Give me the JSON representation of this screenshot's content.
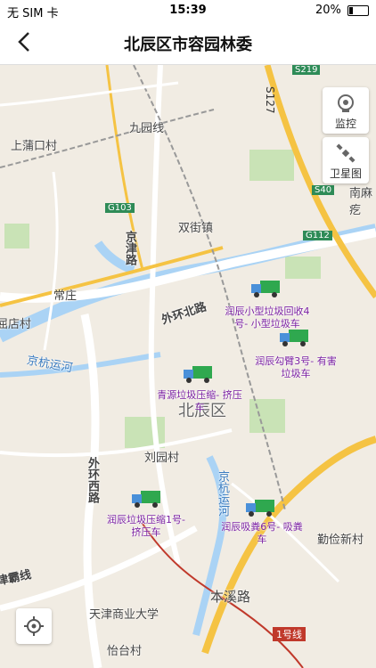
{
  "status": {
    "carrier": "无 SIM 卡",
    "time": "15:39",
    "battery": "20%"
  },
  "nav": {
    "title": "北辰区市容园林委"
  },
  "controls": {
    "monitor": "监控",
    "satellite": "卫星图"
  },
  "map_labels": {
    "beichen": "北辰区",
    "jiuyuan": "九园线",
    "shangpukou": "上蒲口村",
    "shuangjie": "双街镇",
    "jinjin": "京津路",
    "changzhuang": "常庄",
    "waihuan_n": "外环北路",
    "jinghang_w": "京杭运河",
    "dianzhuang": "屈店村",
    "liuyuan": "刘园村",
    "waihuan_w": "外环西路",
    "jinghang_s": "京杭运河",
    "benxi": "本溪路",
    "shangye": "天津商业大学",
    "yitai": "怡台村",
    "qinba": "津霸线",
    "qinfa": "勤俭新村",
    "nanma": "南麻疙",
    "line1": "1号线",
    "s127": "S127",
    "s219": "S219",
    "s40": "S40",
    "g112": "G112",
    "g103": "G103"
  },
  "vehicles": [
    {
      "name": "润辰小型垃圾回收4号- 小型垃圾车"
    },
    {
      "name": "润辰勾臂3号- 有害垃圾车"
    },
    {
      "name": "青源垃圾压缩- 挤压车"
    },
    {
      "name": "润辰垃圾压缩1号- 挤压车"
    },
    {
      "name": "润辰吸粪6号- 吸粪车"
    }
  ],
  "colors": {
    "truck_body": "#2fa84f",
    "truck_cab": "#4a90d9",
    "vehicle_label": "#7a1fa2",
    "highway": "#f5c343",
    "rail": "#c0392b"
  }
}
